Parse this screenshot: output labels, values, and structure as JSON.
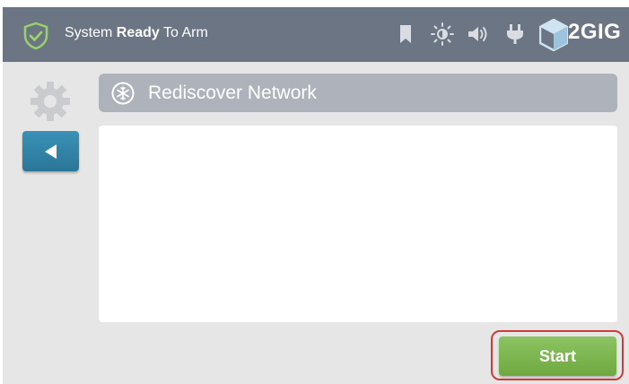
{
  "status_bar": {
    "status_prefix": "System ",
    "status_bold": "Ready",
    "status_suffix": " To Arm",
    "brand": "2GIG",
    "icons": [
      "shield-check-icon",
      "bookmark-icon",
      "brightness-icon",
      "volume-icon",
      "power-plug-icon",
      "brand-logo-icon"
    ]
  },
  "sidebar": {
    "icons": [
      "gear-icon",
      "back-arrow-icon"
    ]
  },
  "page": {
    "title": "Rediscover Network",
    "title_icon": "snowflake-icon"
  },
  "actions": {
    "start_label": "Start"
  },
  "colors": {
    "status_bar": "#6c7584",
    "background": "#e6e6e6",
    "accent_blue": "#2a7698",
    "start_green": "#7cb64f",
    "highlight_red": "#d23a3a"
  }
}
